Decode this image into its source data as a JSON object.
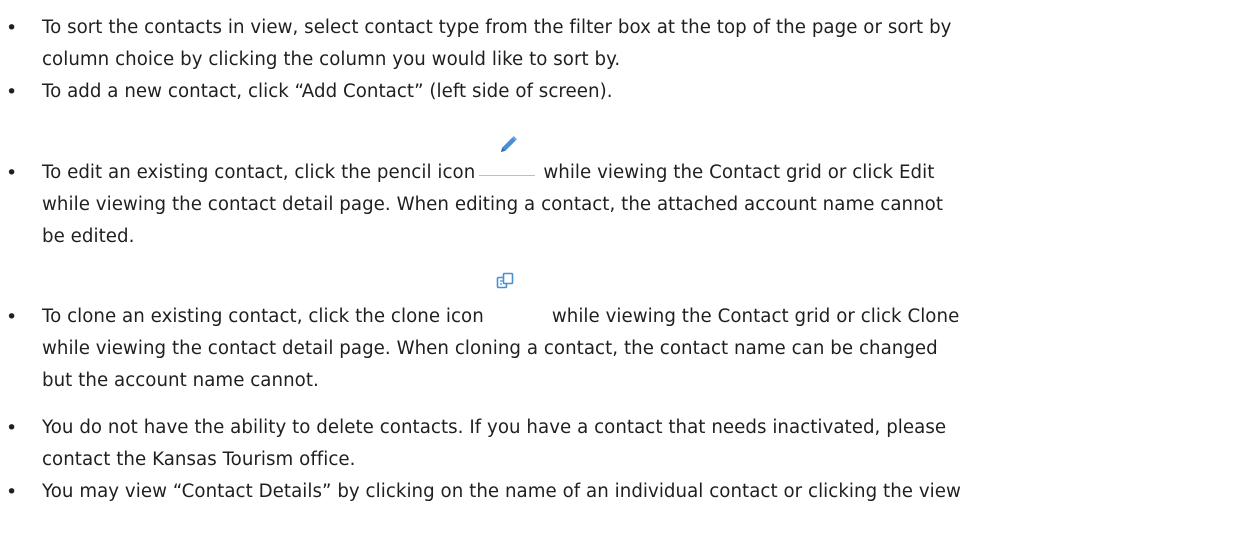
{
  "bullet_char": "•",
  "icons": {
    "pencil": "pencil-icon",
    "clone": "clone-icon",
    "accent_color": "#4a8fd4"
  },
  "items": [
    {
      "lines": [
        "To sort the contacts in view, select contact type from the filter box at the top of the page or sort by",
        "column choice by clicking the column you would like to sort by."
      ]
    },
    {
      "lines": [
        "To add a new contact, click “Add Contact” (left side of screen)."
      ]
    },
    {
      "line1_before": "To edit an existing contact, click the pencil icon",
      "line1_after": "while viewing the Contact grid or click Edit",
      "lines": [
        "while viewing the contact detail page. When editing a contact, the attached account name cannot",
        "be edited."
      ]
    },
    {
      "line1_before": "To clone an existing contact, click the clone icon",
      "line1_after": "while viewing the Contact grid or click Clone",
      "lines": [
        "while viewing the contact detail page. When cloning a contact, the contact name can be changed",
        "but the account name cannot."
      ]
    },
    {
      "lines": [
        "You do not have the ability to delete contacts. If you have a contact that needs inactivated, please",
        "contact the Kansas Tourism office."
      ]
    },
    {
      "lines": [
        "You may view “Contact Details” by clicking on the name of an individual contact or clicking the view"
      ]
    }
  ]
}
